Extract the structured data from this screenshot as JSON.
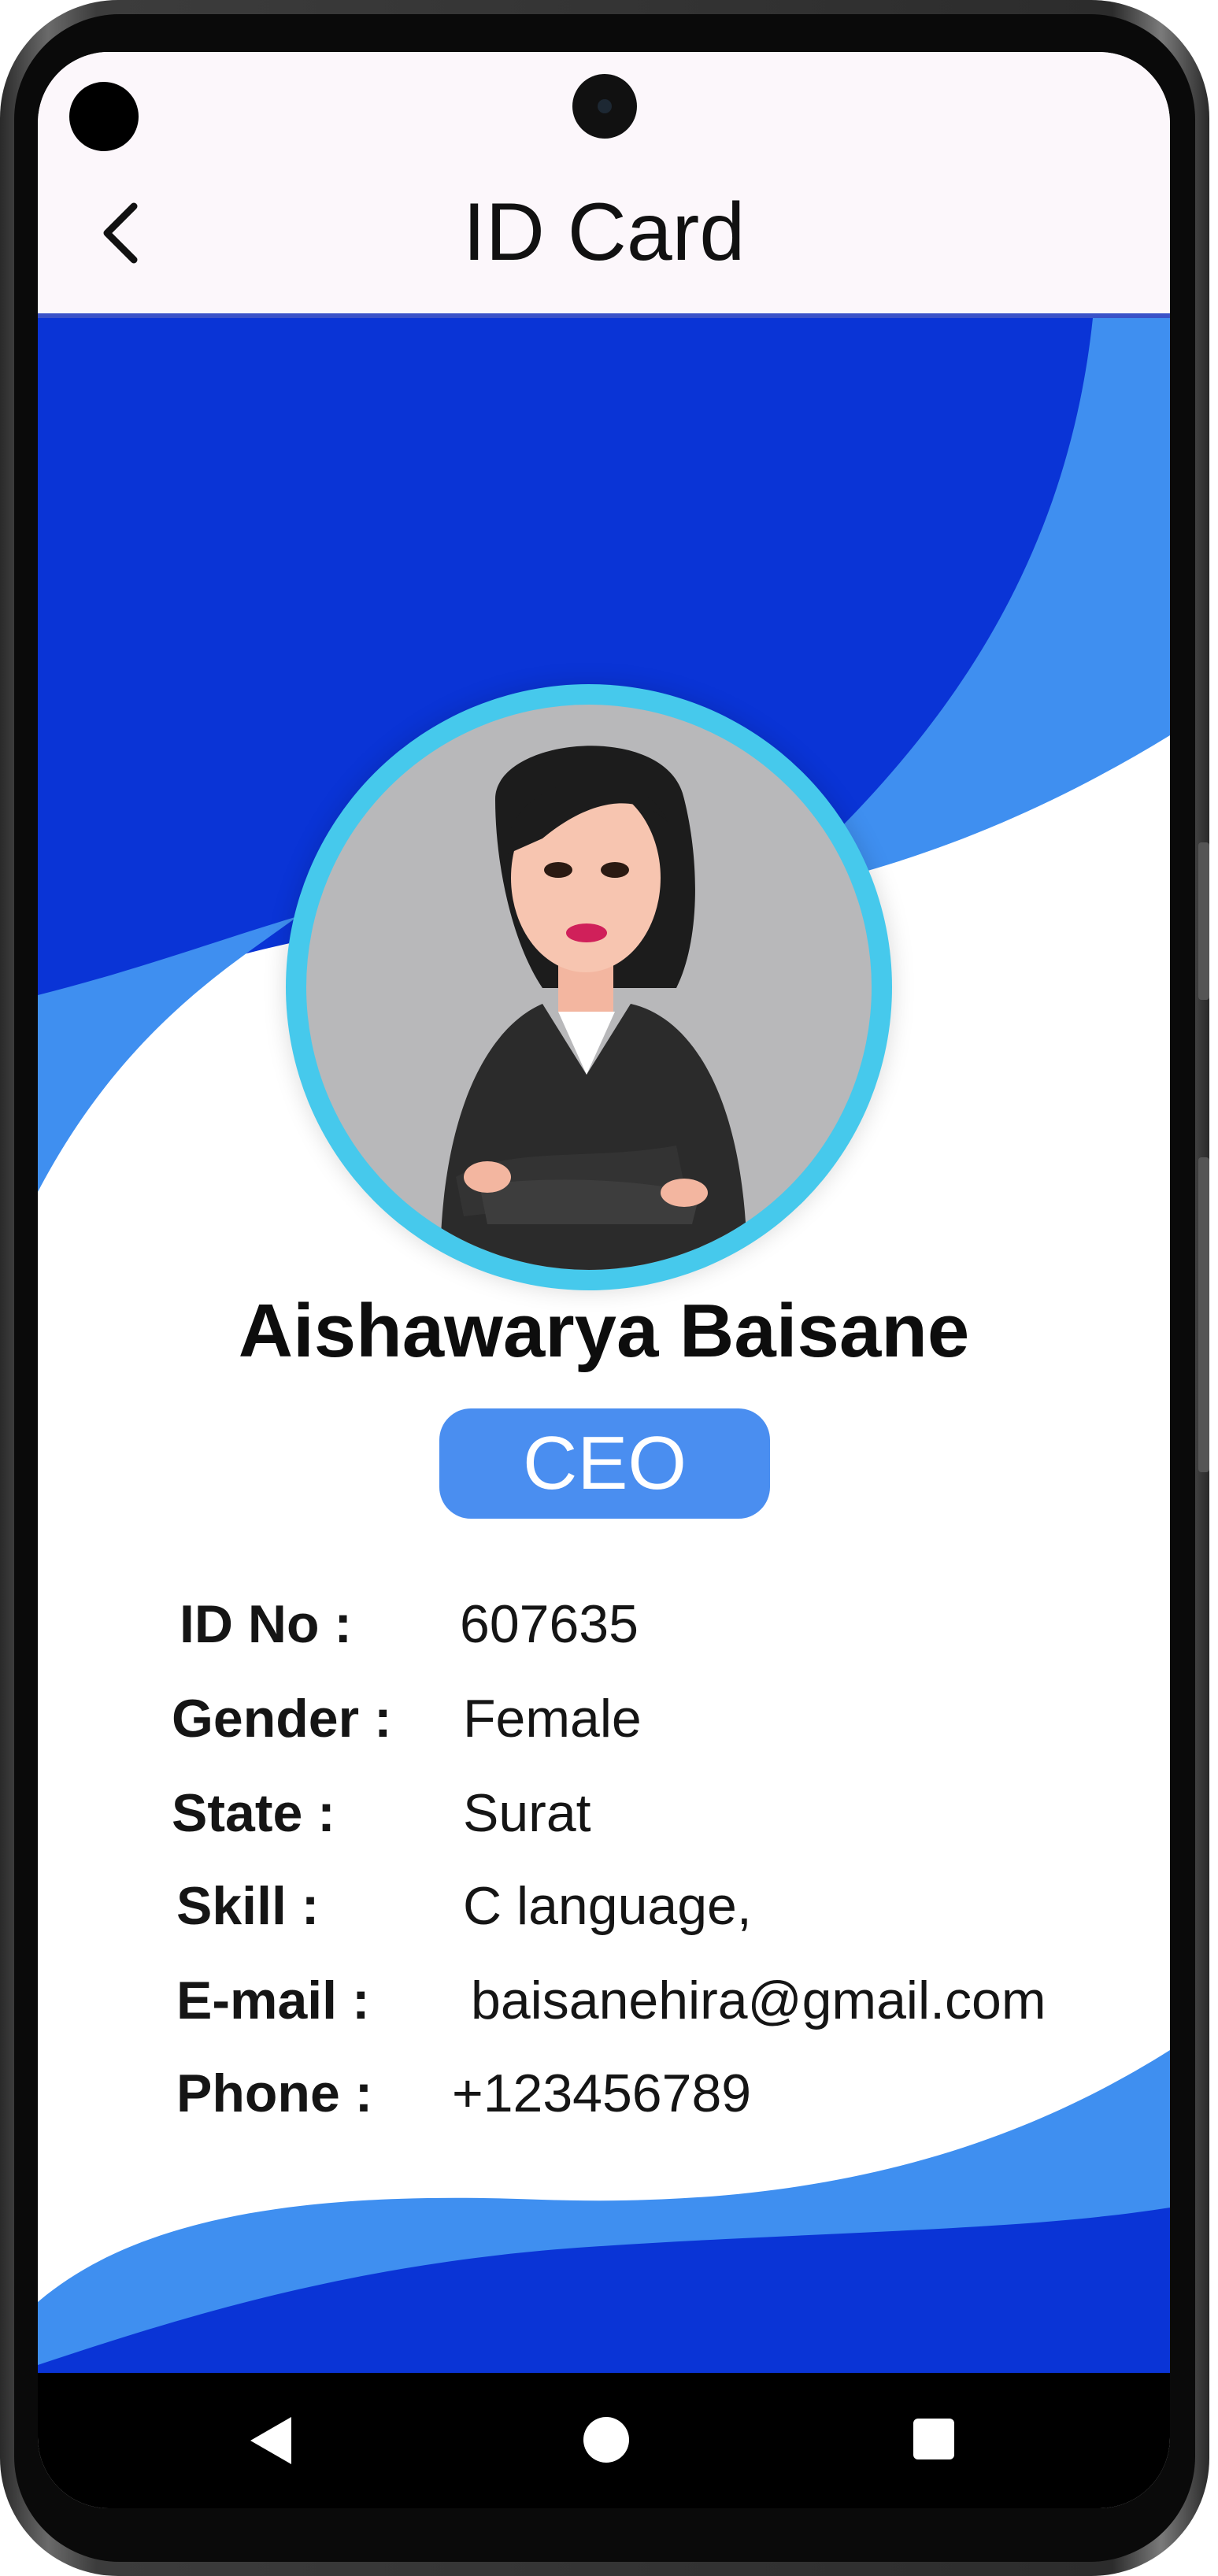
{
  "app_bar": {
    "title": "ID Card"
  },
  "profile": {
    "name": "Aishawarya Baisane",
    "role": "CEO"
  },
  "details": [
    {
      "label": "ID No :",
      "value": "607635"
    },
    {
      "label": "Gender :",
      "value": "Female"
    },
    {
      "label": "State :",
      "value": "Surat"
    },
    {
      "label": "Skill :",
      "value": "C language,"
    },
    {
      "label": "E-mail :",
      "value": "baisanehira@gmail.com"
    },
    {
      "label": "Phone :",
      "value": "+123456789"
    }
  ],
  "icons": {
    "back": "chevron-left-icon",
    "nav_back": "triangle-back-icon",
    "nav_home": "circle-home-icon",
    "nav_recent": "square-recent-icon"
  },
  "colors": {
    "dark_blue": "#0a34d6",
    "light_blue": "#3f8ff0",
    "badge": "#4a8ef0",
    "avatar_ring": "#46c9ec"
  }
}
